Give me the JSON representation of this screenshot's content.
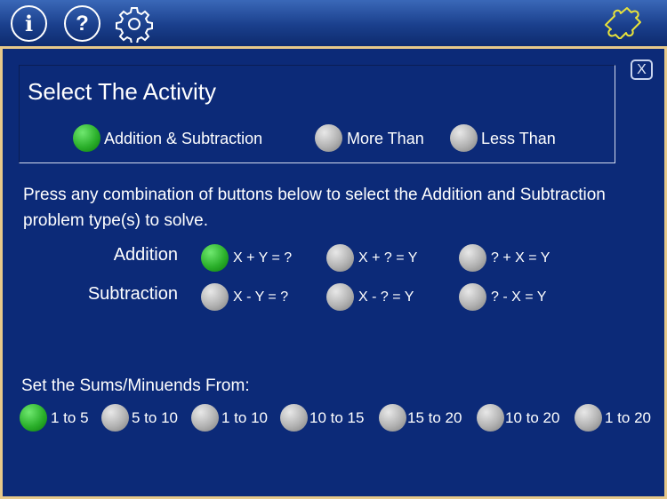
{
  "toolbar": {
    "info_icon_glyph": "i",
    "help_icon_glyph": "?",
    "settings_icon": "gear-icon",
    "puzzle_icon": "puzzle-icon",
    "accent_color": "#e7c98a",
    "puzzle_color": "#e8e23a"
  },
  "dialog": {
    "close_label": "X",
    "activity": {
      "title": "Select The Activity",
      "options": [
        {
          "label": "Addition & Subtraction",
          "selected": true
        },
        {
          "label": "More Than",
          "selected": false
        },
        {
          "label": "Less Than",
          "selected": false
        }
      ]
    },
    "instructions": "Press any combination of buttons below to select the Addition and Subtraction problem type(s) to solve.",
    "problem_types": {
      "addition": {
        "label": "Addition",
        "options": [
          {
            "label": "X + Y = ?",
            "selected": true
          },
          {
            "label": "X + ? = Y",
            "selected": false
          },
          {
            "label": "? + X = Y",
            "selected": false
          }
        ]
      },
      "subtraction": {
        "label": "Subtraction",
        "options": [
          {
            "label": "X - Y = ?",
            "selected": false
          },
          {
            "label": "X - ? = Y",
            "selected": false
          },
          {
            "label": "? - X = Y",
            "selected": false
          }
        ]
      }
    },
    "ranges": {
      "title": "Set the Sums/Minuends From:",
      "options": [
        {
          "label": "1 to 5",
          "selected": true
        },
        {
          "label": "5 to 10",
          "selected": false
        },
        {
          "label": "1 to 10",
          "selected": false
        },
        {
          "label": "10 to 15",
          "selected": false
        },
        {
          "label": "15 to 20",
          "selected": false
        },
        {
          "label": "10 to 20",
          "selected": false
        },
        {
          "label": "1 to 20",
          "selected": false
        }
      ]
    }
  }
}
